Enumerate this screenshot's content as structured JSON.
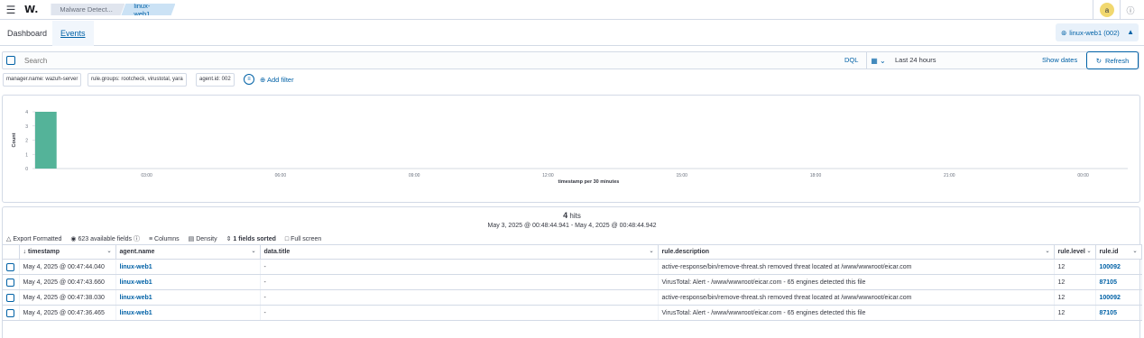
{
  "header": {
    "logo": "W.",
    "breadcrumbs": [
      "Malware Detect...",
      "linux-web1"
    ],
    "avatar_letter": "a"
  },
  "tabs": [
    {
      "label": "Dashboard",
      "active": false
    },
    {
      "label": "Events",
      "active": true
    }
  ],
  "agent_pill": "linux-web1 (002)",
  "search": {
    "placeholder": "Search",
    "dql_label": "DQL",
    "date_range": "Last 24 hours",
    "show_dates": "Show dates",
    "refresh": "Refresh"
  },
  "filters": {
    "pills": [
      "manager.name: wazuh-server",
      "rule.groups: rootcheck, virustotal, yara",
      "agent.id: 002"
    ],
    "add_filter": "Add filter"
  },
  "chart_data": {
    "type": "bar",
    "x": [
      "03:00",
      "06:00",
      "09:00",
      "12:00",
      "15:00",
      "18:00",
      "21:00",
      "00:00"
    ],
    "bars": [
      {
        "x": "00:30",
        "y": 4
      }
    ],
    "ylabel": "Count",
    "xlabel": "timestamp per 30 minutes",
    "yticks": [
      0,
      1,
      2,
      3,
      4
    ],
    "ylim": [
      0,
      4
    ],
    "color": "#54b399"
  },
  "results": {
    "hits_count": "4",
    "hits_label": "hits",
    "range": "May 3, 2025 @ 00:48:44.941 - May 4, 2025 @ 00:48:44.942",
    "toolbar": {
      "export": "Export Formatted",
      "fields": "623 available fields",
      "columns": "Columns",
      "density": "Density",
      "sorted": "1 fields sorted",
      "fullscreen": "Full screen"
    },
    "columns": [
      "timestamp",
      "agent.name",
      "data.title",
      "rule.description",
      "rule.level",
      "rule.id"
    ],
    "rows": [
      {
        "timestamp": "May 4, 2025 @ 00:47:44.040",
        "agent": "linux-web1",
        "title": "-",
        "description": "active-response/bin/remove-threat.sh removed threat located at /www/wwwroot/eicar.com",
        "level": "12",
        "id": "100092"
      },
      {
        "timestamp": "May 4, 2025 @ 00:47:43.660",
        "agent": "linux-web1",
        "title": "-",
        "description": "VirusTotal: Alert - /www/wwwroot/eicar.com - 65 engines detected this file",
        "level": "12",
        "id": "87105"
      },
      {
        "timestamp": "May 4, 2025 @ 00:47:38.030",
        "agent": "linux-web1",
        "title": "-",
        "description": "active-response/bin/remove-threat.sh removed threat located at /www/wwwroot/eicar.com",
        "level": "12",
        "id": "100092"
      },
      {
        "timestamp": "May 4, 2025 @ 00:47:36.465",
        "agent": "linux-web1",
        "title": "-",
        "description": "VirusTotal: Alert - /www/wwwroot/eicar.com - 65 engines detected this file",
        "level": "12",
        "id": "87105"
      }
    ]
  }
}
